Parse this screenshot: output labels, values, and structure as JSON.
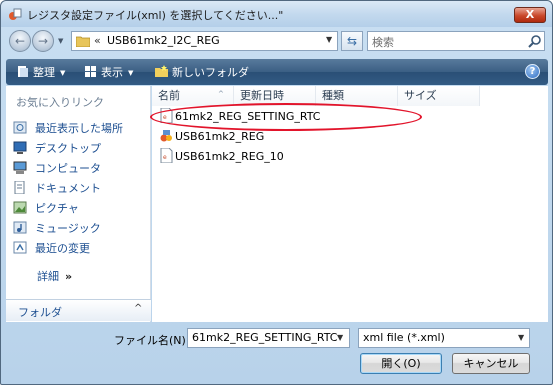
{
  "window": {
    "title": "レジスタ設定ファイル(xml) を選択してください...\"",
    "close_label": "X"
  },
  "address": {
    "chevron": "«",
    "path": "USB61mk2_I2C_REG",
    "search_placeholder": "検索"
  },
  "toolbar": {
    "organize_label": "整理",
    "view_label": "表示",
    "new_folder_label": "新しいフォルダ",
    "help_label": "?"
  },
  "navigation": {
    "favorites_heading": "お気に入りリンク",
    "links": [
      {
        "label": "最近表示した場所",
        "icon": "recent-places-icon"
      },
      {
        "label": "デスクトップ",
        "icon": "desktop-icon"
      },
      {
        "label": "コンピュータ",
        "icon": "computer-icon"
      },
      {
        "label": "ドキュメント",
        "icon": "documents-icon"
      },
      {
        "label": "ピクチャ",
        "icon": "pictures-icon"
      },
      {
        "label": "ミュージック",
        "icon": "music-icon"
      },
      {
        "label": "最近の変更",
        "icon": "recent-changes-icon"
      }
    ],
    "details_label": "詳細",
    "details_chevron": "»",
    "folders_label": "フォルダ",
    "folders_chevron": "^"
  },
  "file_list": {
    "columns": [
      "名前",
      "更新日時",
      "種類",
      "サイズ"
    ],
    "files": [
      {
        "name": "61mk2_REG_SETTING_RTC",
        "icon": "xml-file-icon",
        "highlighted": true
      },
      {
        "name": "USB61mk2_REG",
        "icon": "application-icon",
        "highlighted": false
      },
      {
        "name": "USB61mk2_REG_10",
        "icon": "xml-file-icon",
        "highlighted": false
      }
    ]
  },
  "footer": {
    "filename_label": "ファイル名(N):",
    "filename_value": "61mk2_REG_SETTING_RTC",
    "filetype_value": "xml file (*.xml)",
    "open_label": "開く(O)",
    "cancel_label": "キャンセル"
  },
  "colors": {
    "highlight_ellipse": "#e2142b",
    "command_bar": "#3b5f84",
    "link_text": "#1d4f91"
  }
}
